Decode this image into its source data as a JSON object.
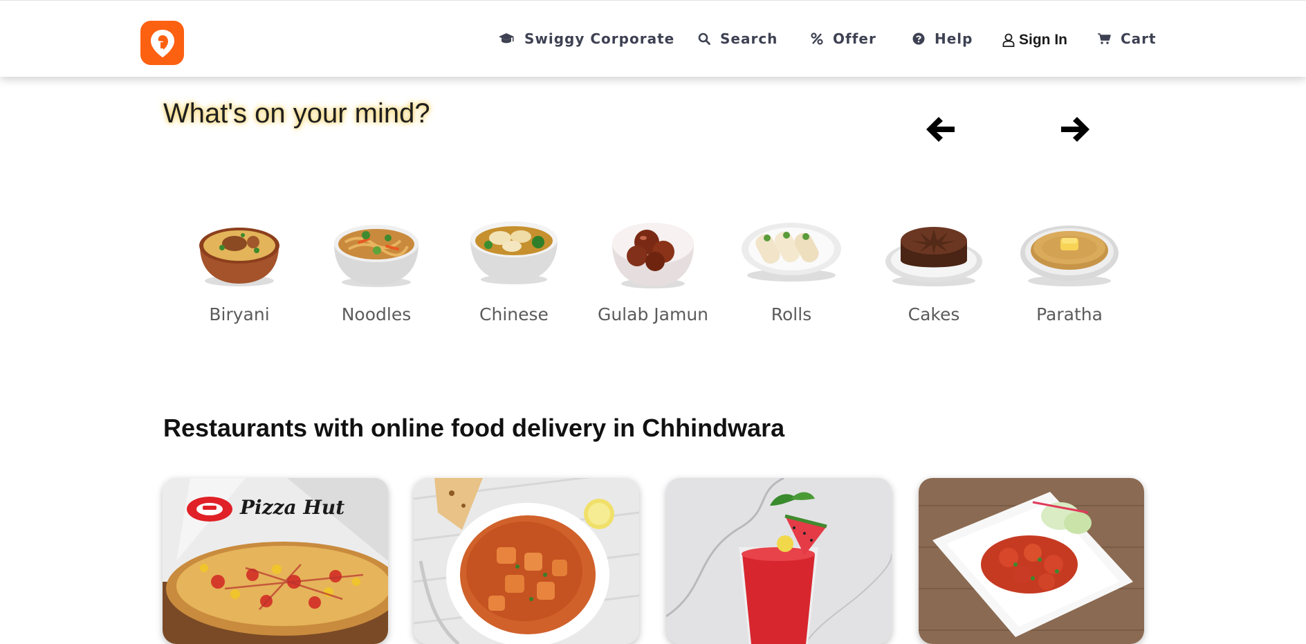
{
  "header": {
    "nav": [
      {
        "label": "Swiggy Corporate",
        "icon": "graduation-cap-icon"
      },
      {
        "label": "Search",
        "icon": "search-icon"
      },
      {
        "label": "Offer",
        "icon": "percent-icon"
      },
      {
        "label": "Help",
        "icon": "help-circle-icon"
      },
      {
        "label": "Sign In",
        "icon": "user-icon"
      },
      {
        "label": "Cart",
        "icon": "cart-icon"
      }
    ],
    "brand_color": "#fc6011"
  },
  "mind": {
    "title": "What's on your mind?",
    "categories": [
      {
        "label": "Biryani"
      },
      {
        "label": "Noodles"
      },
      {
        "label": "Chinese"
      },
      {
        "label": "Gulab Jamun"
      },
      {
        "label": "Rolls"
      },
      {
        "label": "Cakes"
      },
      {
        "label": "Paratha"
      }
    ]
  },
  "restaurants": {
    "title": "Restaurants with online food delivery in Chhindwara",
    "cards": [
      {
        "brand_text": "Pizza Hut"
      },
      {
        "brand_text": ""
      },
      {
        "brand_text": ""
      },
      {
        "brand_text": ""
      }
    ]
  }
}
